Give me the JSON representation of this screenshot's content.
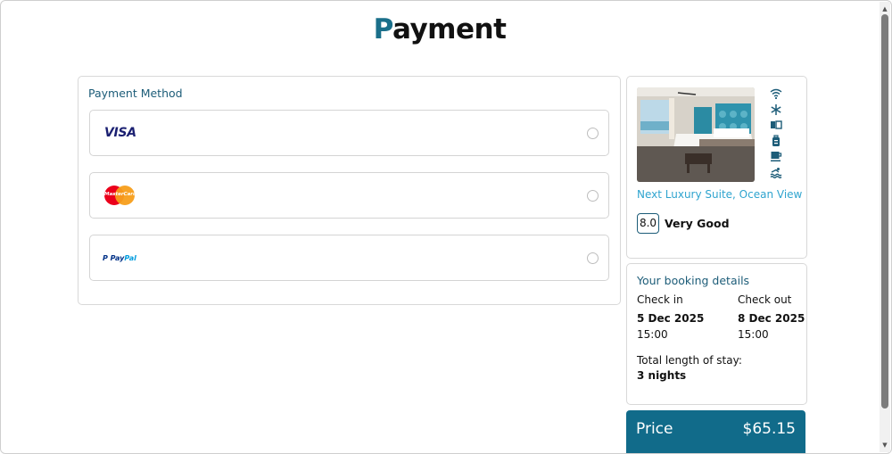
{
  "page": {
    "title_first": "P",
    "title_rest": "ayment"
  },
  "payment_method": {
    "title": "Payment Method",
    "options": [
      {
        "brand": "VISA",
        "selected": false
      },
      {
        "brand": "MasterCard",
        "selected": false
      },
      {
        "brand": "PayPal",
        "brand_part1": "Pay",
        "brand_part2": "Pal",
        "selected": false
      }
    ]
  },
  "hotel": {
    "room_name": "Next Luxury Suite, Ocean View",
    "score": "8.0",
    "score_label": "Very Good",
    "amenities": [
      "wifi-icon",
      "snowflake-icon",
      "tv-icon",
      "luggage-icon",
      "coffee-icon",
      "pool-icon"
    ]
  },
  "booking": {
    "title": "Your booking details",
    "check_in": {
      "label": "Check in",
      "date": "5 Dec 2025",
      "time": "15:00"
    },
    "check_out": {
      "label": "Check out",
      "date": "8 Dec 2025",
      "time": "15:00"
    },
    "total_label": "Total length of stay:",
    "total_value": "3 nights"
  },
  "price": {
    "label": "Price",
    "value": "$65.15"
  },
  "colors": {
    "accent": "#116b8a",
    "link": "#2fa4cf",
    "heading": "#1c5c78"
  }
}
